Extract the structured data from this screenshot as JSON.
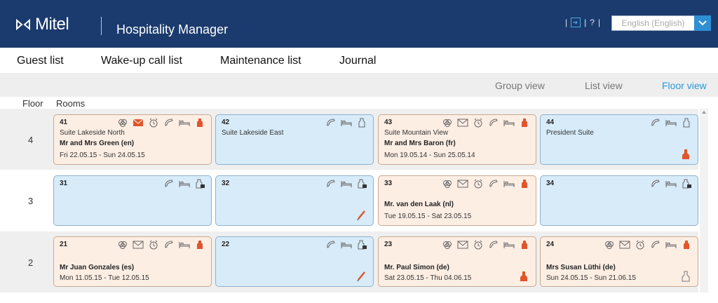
{
  "header": {
    "logo_text": "Mitel",
    "app_title": "Hospitality Manager",
    "tool_sep": "|",
    "help": "?",
    "language": "English (English)",
    "bg_color": "#1b3b6e"
  },
  "nav": {
    "items": [
      "Guest list",
      "Wake-up call list",
      "Maintenance list",
      "Journal"
    ]
  },
  "views": {
    "items": [
      "Group view",
      "List view",
      "Floor view"
    ],
    "active": "Floor view",
    "active_color": "#2b97d6"
  },
  "columns": {
    "floor": "Floor",
    "rooms": "Rooms"
  },
  "floors": [
    {
      "label": "4"
    },
    {
      "label": "3"
    },
    {
      "label": "2"
    }
  ],
  "rooms": {
    "r41": {
      "number": "41",
      "name": "Suite Lakeside North",
      "guest": "Mr and Mrs Green (en)",
      "dates": "Fri 22.05.15 - Sun 24.05.15"
    },
    "r42": {
      "number": "42",
      "name": "Suite Lakeside East"
    },
    "r43": {
      "number": "43",
      "name": "Suite Mountain View",
      "guest": "Mr and Mrs Baron (fr)",
      "dates": "Mon 19.05.14 - Sun 25.05.14"
    },
    "r44": {
      "number": "44",
      "name": "President Suite"
    },
    "r31": {
      "number": "31"
    },
    "r32": {
      "number": "32"
    },
    "r33": {
      "number": "33",
      "guest": "Mr. van den Laak (nl)",
      "dates": "Tue 19.05.15 - Sat 23.05.15"
    },
    "r34": {
      "number": "34"
    },
    "r21": {
      "number": "21",
      "guest": "Mr Juan Gonzales (es)",
      "dates": "Mon 11.05.15 - Tue 12.05.15"
    },
    "r22": {
      "number": "22"
    },
    "r23": {
      "number": "23",
      "guest": "Mr. Paul Simon (de)",
      "dates": "Sat 23.05.15 - Thu 04.06.15"
    },
    "r24": {
      "number": "24",
      "guest": "Mrs Susan Lüthi (de)",
      "dates": "Sun 24.05.15 - Sun 21.06.15"
    }
  },
  "colors": {
    "occupied": "#fdeee4",
    "vacant": "#d7ebf9",
    "alert": "#e0552b"
  }
}
